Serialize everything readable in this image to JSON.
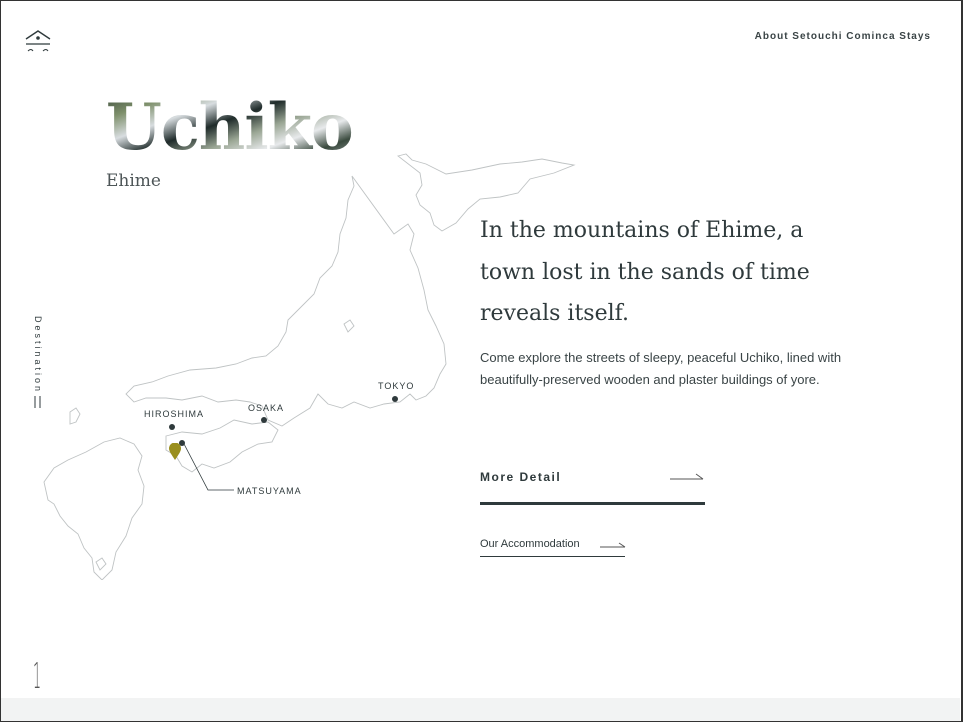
{
  "header": {
    "logo_icon": "house-roof-icon",
    "about_link": "About Setouchi Cominca Stays"
  },
  "destination": {
    "town": "Uchiko",
    "prefecture": "Ehime",
    "side_label": "Destination",
    "page_number": "1"
  },
  "map": {
    "labels": {
      "tokyo": "TOKYO",
      "osaka": "OSAKA",
      "hiroshima": "HIROSHIMA",
      "matsuyama": "MATSUYAMA"
    },
    "pin_color": "#9a8f1e",
    "outline_color": "#bfc3c4",
    "pin_icon": "map-pin-icon"
  },
  "content": {
    "headline": "In the mountains of Ehime, a town lost in the sands of time reveals itself.",
    "description": "Come explore the streets of sleepy, peaceful Uchiko, lined with beautifully-preserved wooden and plaster buildings of yore.",
    "more_button": "More Detail",
    "accommodation_link": "Our Accommodation"
  },
  "colors": {
    "text": "#2f3a3c",
    "accent": "#9a8f1e",
    "footer": "#f2f3f3"
  }
}
